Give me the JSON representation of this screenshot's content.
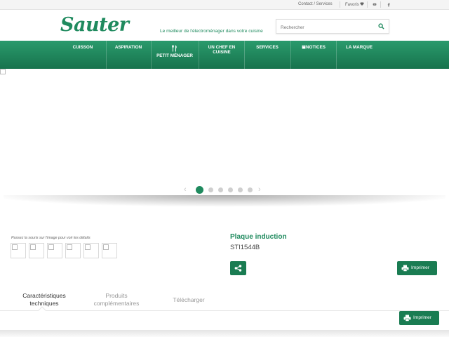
{
  "topbar": {
    "contact_label": "Contact / Services",
    "favoris_label": "Favoris"
  },
  "header": {
    "logo_text": "Sauter",
    "tagline": "Le meilleur de l'électroménager dans votre cuisine",
    "search_placeholder": "Rechercher"
  },
  "nav": {
    "items": [
      {
        "label": "CUISSON"
      },
      {
        "label": "ASPIRATION"
      },
      {
        "label": "PETIT MÉNAGER"
      },
      {
        "label": "UN CHEF EN CUISINE"
      },
      {
        "label": "SERVICES"
      },
      {
        "label": "NOTICES"
      },
      {
        "label": "LA MARQUE"
      }
    ]
  },
  "carousel": {
    "slide_count": 6,
    "active_index": 0
  },
  "product": {
    "zoom_hint": "Passez la souris sur l'image pour voir les détails",
    "title": "Plaque induction",
    "reference": "STI1544B",
    "print_label": "Imprimer"
  },
  "tabs": [
    {
      "label_line1": "Caractéristiques",
      "label_line2": "techniques"
    },
    {
      "label_line1": "Produits",
      "label_line2": "complémentaires"
    },
    {
      "label_line1": "Télécharger",
      "label_line2": ""
    }
  ],
  "sticky_print_label": "Imprimer",
  "colors": {
    "brand_green": "#1f8a5e",
    "button_green": "#1a7c52"
  },
  "icons": {
    "favoris": "heart-icon",
    "youtube": "youtube-icon",
    "facebook": "facebook-icon",
    "search": "search-icon",
    "share": "share-icon",
    "print": "printer-icon",
    "petit_menager": "utensils-icon",
    "notices": "book-icon"
  }
}
